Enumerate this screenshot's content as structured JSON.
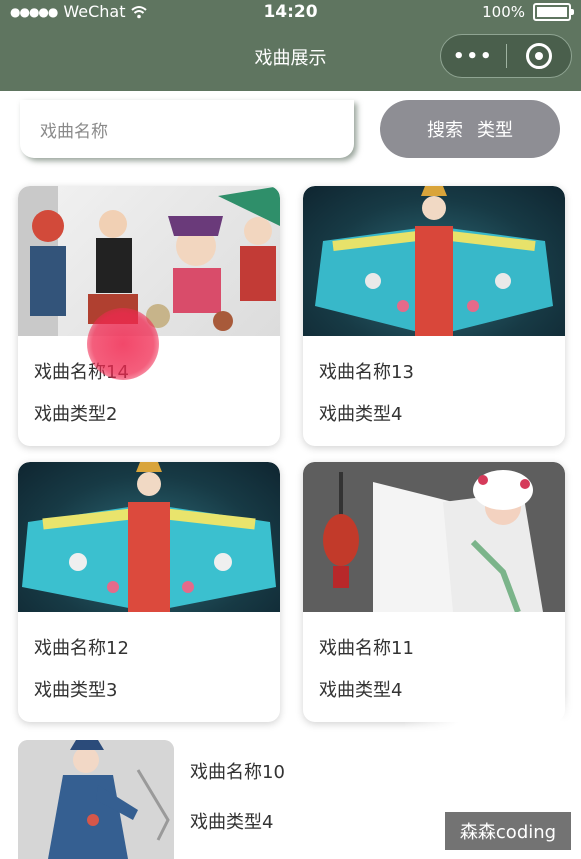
{
  "status_bar": {
    "signal": "●●●●●",
    "carrier": "WeChat",
    "time": "14:20",
    "battery_text": "100%"
  },
  "nav": {
    "title": "戏曲展示",
    "more_label": "•••"
  },
  "search": {
    "placeholder": "戏曲名称",
    "search_label": "搜索",
    "type_label": "类型"
  },
  "cards": [
    {
      "name": "戏曲名称14",
      "type": "戏曲类型2",
      "image": "opera-cartoon-collage"
    },
    {
      "name": "戏曲名称13",
      "type": "戏曲类型4",
      "image": "opera-dancer-blue-robe"
    },
    {
      "name": "戏曲名称12",
      "type": "戏曲类型3",
      "image": "opera-dancer-blue-robe"
    },
    {
      "name": "戏曲名称11",
      "type": "戏曲类型4",
      "image": "opera-performer-lantern"
    }
  ],
  "list_item": {
    "name": "戏曲名称10",
    "type": "戏曲类型4",
    "image": "opera-figure"
  },
  "watermark": "森森coding",
  "colors": {
    "nav_bg": "#5f7560",
    "search_button": "#8e8e94",
    "touch_indicator": "#f02850"
  }
}
